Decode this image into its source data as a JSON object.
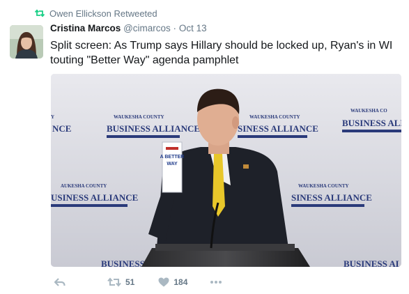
{
  "retweet_line": {
    "text": "Owen Ellickson Retweeted",
    "icon": "retweet-icon",
    "color": "#19cf86"
  },
  "author": {
    "name": "Cristina Marcos",
    "handle": "@cimarcos",
    "separator": "·",
    "date": "Oct 13"
  },
  "tweet": {
    "text": "Split screen: As Trump says Hillary should be locked up, Ryan's in WI touting \"Better Way\" agenda pamphlet"
  },
  "media": {
    "backdrop_brand_top": "WAUKESHA COUNTY",
    "backdrop_brand_bottom": "BUSINESS ALLIANCE",
    "backdrop_left_partial_top": "Y",
    "backdrop_left_partial_bottom": "NCE",
    "backdrop_right_partial_top": "WAUKESHA CO",
    "backdrop_right_partial_bottom": "BUSINESS ALLI",
    "backdrop_mid_top": "WAUKESHA COUNTY",
    "backdrop_mid_bottom": "SINESS ALLIANCE",
    "backdrop_low_left_top": "AUKESHA COUNTY",
    "backdrop_low_left_bottom": "USINESS ALLIANCE",
    "backdrop_low_right_top": "WAUKESHA COUNTY",
    "backdrop_low_right_bottom": "SINESS ALLIANCE",
    "backdrop_foot_left": "BUSINESS A",
    "backdrop_foot_right": "BUSINESS ALL",
    "pamphlet_line1": "A BETTER",
    "pamphlet_line2": "WAY"
  },
  "actions": {
    "reply_icon": "reply-icon",
    "retweet_icon": "retweet-icon",
    "retweet_count": "51",
    "like_icon": "heart-icon",
    "like_count": "184",
    "more_icon": "more-dots-icon"
  },
  "colors": {
    "text": "#14171a",
    "muted": "#657786",
    "action_icon": "#aab8c2",
    "retweet_green": "#19cf86"
  }
}
